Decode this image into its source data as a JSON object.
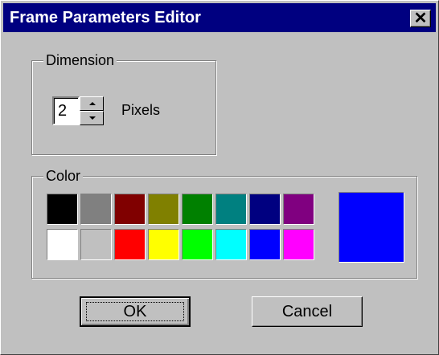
{
  "window": {
    "title": "Frame Parameters Editor",
    "close_glyph": "✕"
  },
  "dimension": {
    "group_label": "Dimension",
    "value": "2",
    "unit_label": "Pixels"
  },
  "color": {
    "group_label": "Color",
    "palette_row1": [
      "#000000",
      "#808080",
      "#800000",
      "#808000",
      "#008000",
      "#008080",
      "#000080",
      "#800080"
    ],
    "palette_row2": [
      "#ffffff",
      "#c0c0c0",
      "#ff0000",
      "#ffff00",
      "#00ff00",
      "#00ffff",
      "#0000ff",
      "#ff00ff"
    ],
    "selected": "#0000ff"
  },
  "buttons": {
    "ok_label": "OK",
    "cancel_label": "Cancel"
  }
}
